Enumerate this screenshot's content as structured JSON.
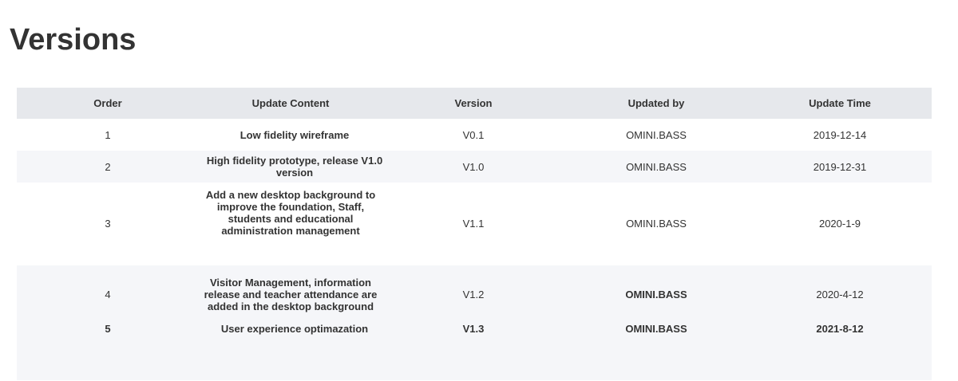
{
  "page": {
    "title": "Versions"
  },
  "table": {
    "headers": {
      "order": "Order",
      "content": "Update Content",
      "version": "Version",
      "updated_by": "Updated by",
      "update_time": "Update Time"
    },
    "rows": [
      {
        "order": "1",
        "content": "Low fidelity wireframe",
        "version": "V0.1",
        "updated_by": "OMINI.BASS",
        "update_time": "2019-12-14"
      },
      {
        "order": "2",
        "content": "High fidelity prototype, release V1.0 version",
        "version": "V1.0",
        "updated_by": "OMINI.BASS",
        "update_time": "2019-12-31"
      },
      {
        "order": "3",
        "content": "Add a new desktop background to improve the foundation, Staff, students and educational administration management",
        "version": "V1.1",
        "updated_by": "OMINI.BASS",
        "update_time": "2020-1-9"
      },
      {
        "order": "4",
        "content": "Visitor Management, information release and teacher attendance are added in the desktop background",
        "version": "V1.2",
        "updated_by": "OMINI.BASS",
        "update_time": "2020-4-12"
      },
      {
        "order": "5",
        "content": "User experience optimazation",
        "version": "V1.3",
        "updated_by": "OMINI.BASS",
        "update_time": "2021-8-12"
      }
    ]
  }
}
